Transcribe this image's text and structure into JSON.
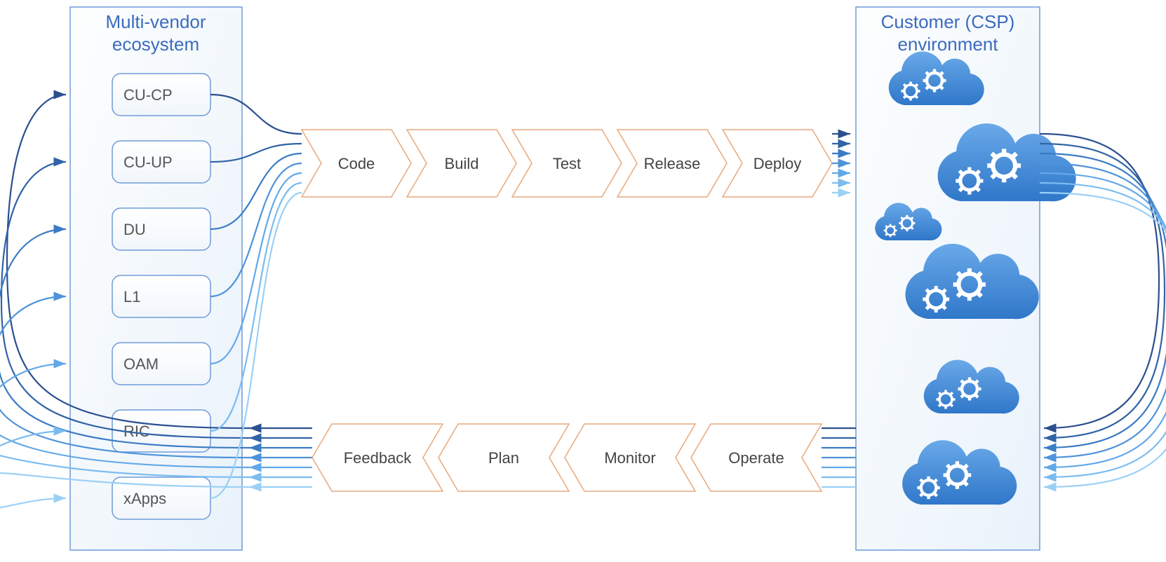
{
  "left_panel": {
    "title_line1": "Multi-vendor",
    "title_line2": "ecosystem",
    "items": [
      "CU-CP",
      "CU-UP",
      "DU",
      "L1",
      "OAM",
      "RIC",
      "xApps"
    ]
  },
  "right_panel": {
    "title_line1": "Customer (CSP)",
    "title_line2": "environment"
  },
  "top_pipeline": [
    "Code",
    "Build",
    "Test",
    "Release",
    "Deploy"
  ],
  "bottom_pipeline": [
    "Feedback",
    "Plan",
    "Monitor",
    "Operate"
  ],
  "flow_colors": [
    "#2b4f8f",
    "#3064a6",
    "#3a7bc4",
    "#4f93da",
    "#63a8e8",
    "#7bbcf0",
    "#9bd0f6"
  ]
}
